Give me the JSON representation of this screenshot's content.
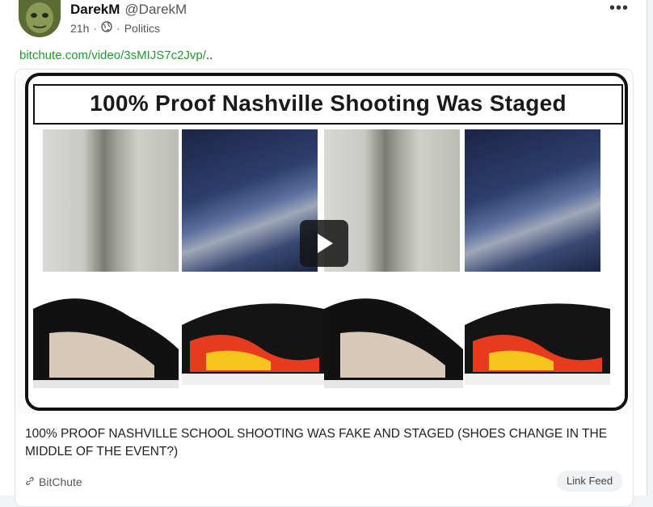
{
  "post": {
    "author_name": "DarekM",
    "author_handle": "@DarekM",
    "time": "21h",
    "category": "Politics",
    "link_text": "bitchute.com/video/3sMIJS7c2Jvp/",
    "link_suffix": ".."
  },
  "preview": {
    "thumbnail_caption": "100% Proof Nashville Shooting Was Staged",
    "title": "100% PROOF NASHVILLE SCHOOL SHOOTING WAS FAKE AND STAGED (SHOES CHANGE IN THE MIDDLE OF THE EVENT?)",
    "source": "BitChute",
    "feed_button": "Link Feed"
  },
  "icons": {
    "more": "more-icon",
    "privacy": "globe-icon",
    "link": "link-icon",
    "play": "play-icon"
  },
  "colors": {
    "link": "#1f9a2e",
    "card": "#ffffff"
  }
}
